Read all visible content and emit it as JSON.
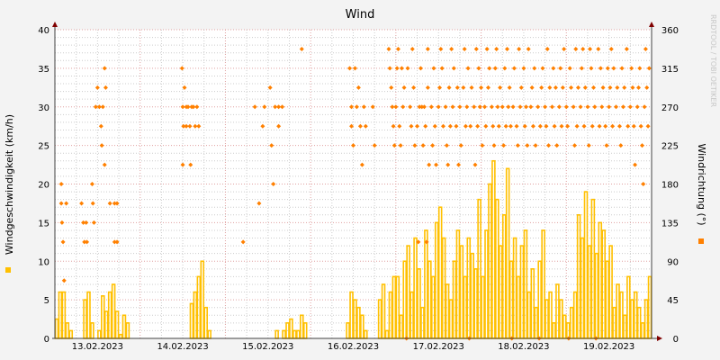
{
  "chart_data": {
    "type": "line",
    "title": "Wind",
    "ylabel": "Windgeschwindigkeit (km/h)",
    "y2label": "Windrichtung (°)",
    "watermark": "RRDTOOL / TOBI OETIKER",
    "ylim": [
      0,
      40
    ],
    "y2lim": [
      0,
      360
    ],
    "yticks": [
      "0",
      "5",
      "10",
      "15",
      "20",
      "25",
      "30",
      "35",
      "40"
    ],
    "y2ticks": [
      "0",
      "45",
      "90",
      "135",
      "180",
      "225",
      "270",
      "315",
      "360"
    ],
    "xticks": [
      "13.02.2023",
      "14.02.2023",
      "15.02.2023",
      "16.02.2023",
      "17.02.2023",
      "18.02.2023",
      "19.02.2023"
    ],
    "grid": true,
    "colors": {
      "speed": "#ffc000",
      "direction": "#ff8000",
      "major_grid": "#e0a0a0",
      "minor_grid": "#cccccc",
      "axis": "#800000"
    },
    "series": [
      {
        "name": "Windgeschwindigkeit",
        "unit": "km/h",
        "resolution_hours": 1,
        "values": [
          2.5,
          6,
          6,
          2,
          1,
          0,
          0,
          0,
          5,
          6,
          2,
          0,
          1,
          5.5,
          3.5,
          6,
          7,
          3.5,
          0.5,
          3,
          2,
          0,
          0,
          0,
          0,
          0,
          0,
          0,
          0,
          0,
          0,
          0,
          0,
          0,
          0,
          0,
          0,
          0,
          4.5,
          6,
          8,
          10,
          4,
          1,
          0,
          0,
          0,
          0,
          0,
          0,
          0,
          0,
          0,
          0,
          0,
          0,
          0,
          0,
          0,
          0,
          0,
          0,
          1,
          0,
          1,
          2,
          2.5,
          1,
          1,
          3,
          2,
          0,
          0,
          0,
          0,
          0,
          0,
          0,
          0,
          0,
          0,
          0,
          2,
          6,
          5,
          4,
          3,
          1,
          0,
          0,
          0,
          5,
          7,
          1,
          6,
          8,
          8,
          3,
          10,
          12,
          6,
          13,
          9,
          4,
          14,
          10,
          8,
          15,
          17,
          13,
          7,
          5,
          10,
          14,
          12,
          8,
          13,
          11,
          9,
          18,
          8,
          14,
          20,
          23,
          18,
          12,
          16,
          22,
          10,
          13,
          8,
          12,
          14,
          6,
          9,
          4,
          10,
          14,
          5,
          6,
          2,
          7,
          5,
          3,
          2,
          4,
          6,
          16,
          13,
          19,
          12,
          18,
          11,
          15,
          14,
          10,
          12,
          4,
          7,
          6,
          3,
          8,
          5,
          6,
          4,
          2,
          5,
          8
        ]
      },
      {
        "name": "Windrichtung",
        "unit": "°",
        "points": [
          [
            1.8,
            180
          ],
          [
            1.8,
            157.5
          ],
          [
            2,
            135
          ],
          [
            2.3,
            112.5
          ],
          [
            2.6,
            67.5
          ],
          [
            3.2,
            157.5
          ],
          [
            7.5,
            157.5
          ],
          [
            8,
            135
          ],
          [
            8.3,
            112.5
          ],
          [
            8.8,
            135
          ],
          [
            9,
            112.5
          ],
          [
            10.5,
            180
          ],
          [
            10.7,
            157.5
          ],
          [
            11,
            135
          ],
          [
            11.5,
            270
          ],
          [
            12,
            292.5
          ],
          [
            12.5,
            270
          ],
          [
            13,
            247.5
          ],
          [
            13.2,
            225
          ],
          [
            13.5,
            270
          ],
          [
            14,
            202.5
          ],
          [
            14,
            315
          ],
          [
            14.3,
            292.5
          ],
          [
            15.5,
            157.5
          ],
          [
            16.8,
            157.5
          ],
          [
            16.8,
            112.5
          ],
          [
            17.5,
            112.5
          ],
          [
            17.5,
            157.5
          ],
          [
            35.8,
            315
          ],
          [
            36,
            270
          ],
          [
            36.2,
            247.5
          ],
          [
            36,
            202.5
          ],
          [
            36.5,
            292.5
          ],
          [
            37,
            270
          ],
          [
            37,
            247.5
          ],
          [
            37.5,
            270
          ],
          [
            38,
            247.5
          ],
          [
            38.2,
            202.5
          ],
          [
            38.5,
            270
          ],
          [
            39,
            270
          ],
          [
            39.5,
            247.5
          ],
          [
            40,
            270
          ],
          [
            40.5,
            247.5
          ],
          [
            53,
            112.5
          ],
          [
            56.3,
            270
          ],
          [
            57.5,
            157.5
          ],
          [
            58.5,
            247.5
          ],
          [
            59,
            270
          ],
          [
            60.6,
            292.5
          ],
          [
            61,
            225
          ],
          [
            61.5,
            180
          ],
          [
            62,
            270
          ],
          [
            63,
            247.5
          ],
          [
            63,
            270
          ],
          [
            64,
            270
          ],
          [
            69.5,
            337.5
          ],
          [
            83,
            315
          ],
          [
            83.5,
            270
          ],
          [
            83.5,
            247.5
          ],
          [
            84,
            225
          ],
          [
            84.5,
            315
          ],
          [
            85,
            270
          ],
          [
            85.5,
            292.5
          ],
          [
            86,
            247.5
          ],
          [
            86.5,
            202.5
          ],
          [
            87,
            270
          ],
          [
            87.5,
            247.5
          ],
          [
            89.5,
            270
          ],
          [
            90,
            225
          ],
          [
            94,
            337.5
          ],
          [
            94.3,
            315
          ],
          [
            94.7,
            292.5
          ],
          [
            95,
            270
          ],
          [
            95.3,
            247.5
          ],
          [
            95.6,
            225
          ]
        ],
        "hourly": [
          [
            96,
            [
              270,
              315,
              337.5
            ]
          ],
          [
            97,
            [
              247.5,
              225,
              315
            ]
          ],
          [
            98,
            [
              270,
              292.5
            ]
          ],
          [
            99,
            [
              0,
              315
            ]
          ],
          [
            100,
            [
              270,
              247.5,
              337.5
            ]
          ],
          [
            101,
            [
              292.5,
              225
            ]
          ],
          [
            102,
            [
              247.5,
              112.5,
              270
            ]
          ],
          [
            103,
            [
              315,
              270,
              225
            ]
          ],
          [
            104,
            [
              270,
              247.5,
              112.5,
              337.5
            ]
          ],
          [
            105,
            [
              292.5,
              202.5
            ]
          ],
          [
            106,
            [
              270,
              225,
              315
            ]
          ],
          [
            107,
            [
              247.5,
              202.5
            ]
          ],
          [
            108,
            [
              270,
              292.5,
              337.5
            ]
          ],
          [
            109,
            [
              315,
              247.5
            ]
          ],
          [
            110,
            [
              270,
              225,
              202.5
            ]
          ],
          [
            111,
            [
              292.5,
              247.5,
              337.5
            ]
          ],
          [
            112,
            [
              270,
              315
            ]
          ],
          [
            113,
            [
              247.5,
              292.5,
              202.5
            ]
          ],
          [
            114,
            [
              270,
              225
            ]
          ],
          [
            115,
            [
              292.5,
              337.5,
              247.5
            ]
          ],
          [
            116,
            [
              270,
              315,
              0
            ]
          ],
          [
            117,
            [
              247.5,
              292.5
            ]
          ],
          [
            118,
            [
              270,
              202.5,
              337.5
            ]
          ],
          [
            119,
            [
              247.5,
              315,
              270
            ]
          ],
          [
            120,
            [
              292.5,
              225
            ]
          ],
          [
            121,
            [
              270,
              247.5,
              337.5
            ]
          ],
          [
            122,
            [
              292.5,
              315
            ]
          ],
          [
            123,
            [
              270,
              247.5,
              225
            ]
          ],
          [
            124,
            [
              315,
              337.5,
              270
            ]
          ],
          [
            125,
            [
              247.5,
              292.5
            ]
          ],
          [
            126,
            [
              270,
              225,
              315
            ]
          ],
          [
            127,
            [
              247.5,
              337.5,
              270
            ]
          ],
          [
            128,
            [
              292.5,
              247.5,
              0
            ]
          ],
          [
            129,
            [
              270,
              315
            ]
          ],
          [
            130,
            [
              247.5,
              225,
              337.5
            ]
          ],
          [
            131,
            [
              270,
              292.5
            ]
          ],
          [
            132,
            [
              315,
              247.5,
              270
            ]
          ],
          [
            133,
            [
              225,
              337.5
            ]
          ],
          [
            134,
            [
              270,
              292.5,
              247.5
            ]
          ],
          [
            135,
            [
              315,
              225
            ]
          ],
          [
            136,
            [
              270,
              0,
              247.5
            ]
          ],
          [
            137,
            [
              292.5,
              315
            ]
          ],
          [
            138,
            [
              270,
              247.5,
              337.5
            ]
          ],
          [
            139,
            [
              225,
              292.5
            ]
          ],
          [
            140,
            [
              270,
              315,
              247.5
            ]
          ],
          [
            141,
            [
              292.5,
              225
            ]
          ],
          [
            142,
            [
              270,
              315,
              247.5
            ]
          ],
          [
            143,
            [
              292.5,
              337.5
            ]
          ],
          [
            144,
            [
              270,
              247.5,
              0
            ]
          ],
          [
            145,
            [
              315,
              292.5
            ]
          ],
          [
            146,
            [
              270,
              225,
              337.5
            ]
          ],
          [
            147,
            [
              247.5,
              292.5
            ]
          ],
          [
            148,
            [
              270,
              315,
              337.5
            ]
          ],
          [
            149,
            [
              247.5,
              292.5
            ]
          ],
          [
            150,
            [
              270,
              225,
              337.5
            ]
          ],
          [
            151,
            [
              315,
              247.5,
              292.5
            ]
          ],
          [
            152,
            [
              270,
              0
            ]
          ],
          [
            153,
            [
              337.5,
              247.5,
              315
            ]
          ],
          [
            154,
            [
              270,
              292.5
            ]
          ],
          [
            155,
            [
              247.5,
              225,
              315
            ]
          ],
          [
            156,
            [
              270,
              292.5,
              337.5
            ]
          ],
          [
            157,
            [
              247.5,
              315
            ]
          ],
          [
            158,
            [
              270,
              292.5
            ]
          ],
          [
            159,
            [
              247.5,
              225,
              315
            ]
          ],
          [
            160,
            [
              270,
              292.5
            ]
          ],
          [
            161,
            [
              337.5,
              247.5
            ]
          ],
          [
            162,
            [
              270,
              315,
              292.5
            ]
          ],
          [
            163,
            [
              247.5,
              202.5
            ]
          ],
          [
            164,
            [
              270,
              292.5,
              315
            ]
          ],
          [
            165,
            [
              247.5,
              225,
              180
            ]
          ],
          [
            166,
            [
              270,
              337.5,
              292.5
            ]
          ],
          [
            167,
            [
              247.5,
              315
            ]
          ]
        ]
      }
    ]
  }
}
